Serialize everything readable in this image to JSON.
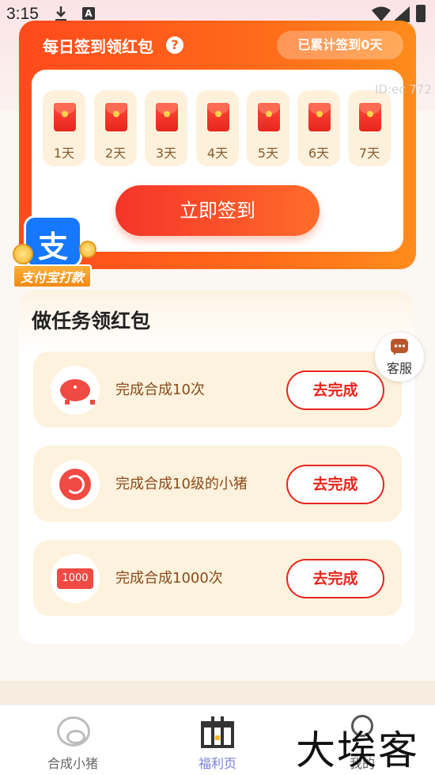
{
  "status_bar": {
    "time": "3:15",
    "a_icon": "A"
  },
  "signin": {
    "title": "每日签到领红包",
    "count_text": "已累计签到0天",
    "days": [
      "1天",
      "2天",
      "3天",
      "4天",
      "5天",
      "6天",
      "7天"
    ],
    "button": "立即签到",
    "watermark_id": "ID:ec 772"
  },
  "alipay_badge": {
    "logo_char": "支",
    "text": "支付宝打款"
  },
  "tasks": {
    "title": "做任务领红包",
    "items": [
      {
        "label": "完成合成10次",
        "button": "去完成",
        "icon": "piggy-bank-icon"
      },
      {
        "label": "完成合成10级的小猪",
        "button": "去完成",
        "icon": "recycle-icon"
      },
      {
        "label": "完成合成1000次",
        "button": "去完成",
        "icon": "count-1000-icon",
        "icon_text": "1000"
      }
    ]
  },
  "customer_service": {
    "label": "客服"
  },
  "nav": [
    {
      "label": "合成小猪",
      "icon": "pig-face-icon",
      "active": false
    },
    {
      "label": "福利页",
      "icon": "gift-icon",
      "active": true
    },
    {
      "label": "我的",
      "icon": "user-icon",
      "active": false
    }
  ],
  "watermark_brand": "大埃客",
  "colors": {
    "primary_orange": "#ff5a1c",
    "button_red": "#e8251c",
    "task_bg": "#fdf2dd",
    "nav_active": "#7a7fd9"
  }
}
